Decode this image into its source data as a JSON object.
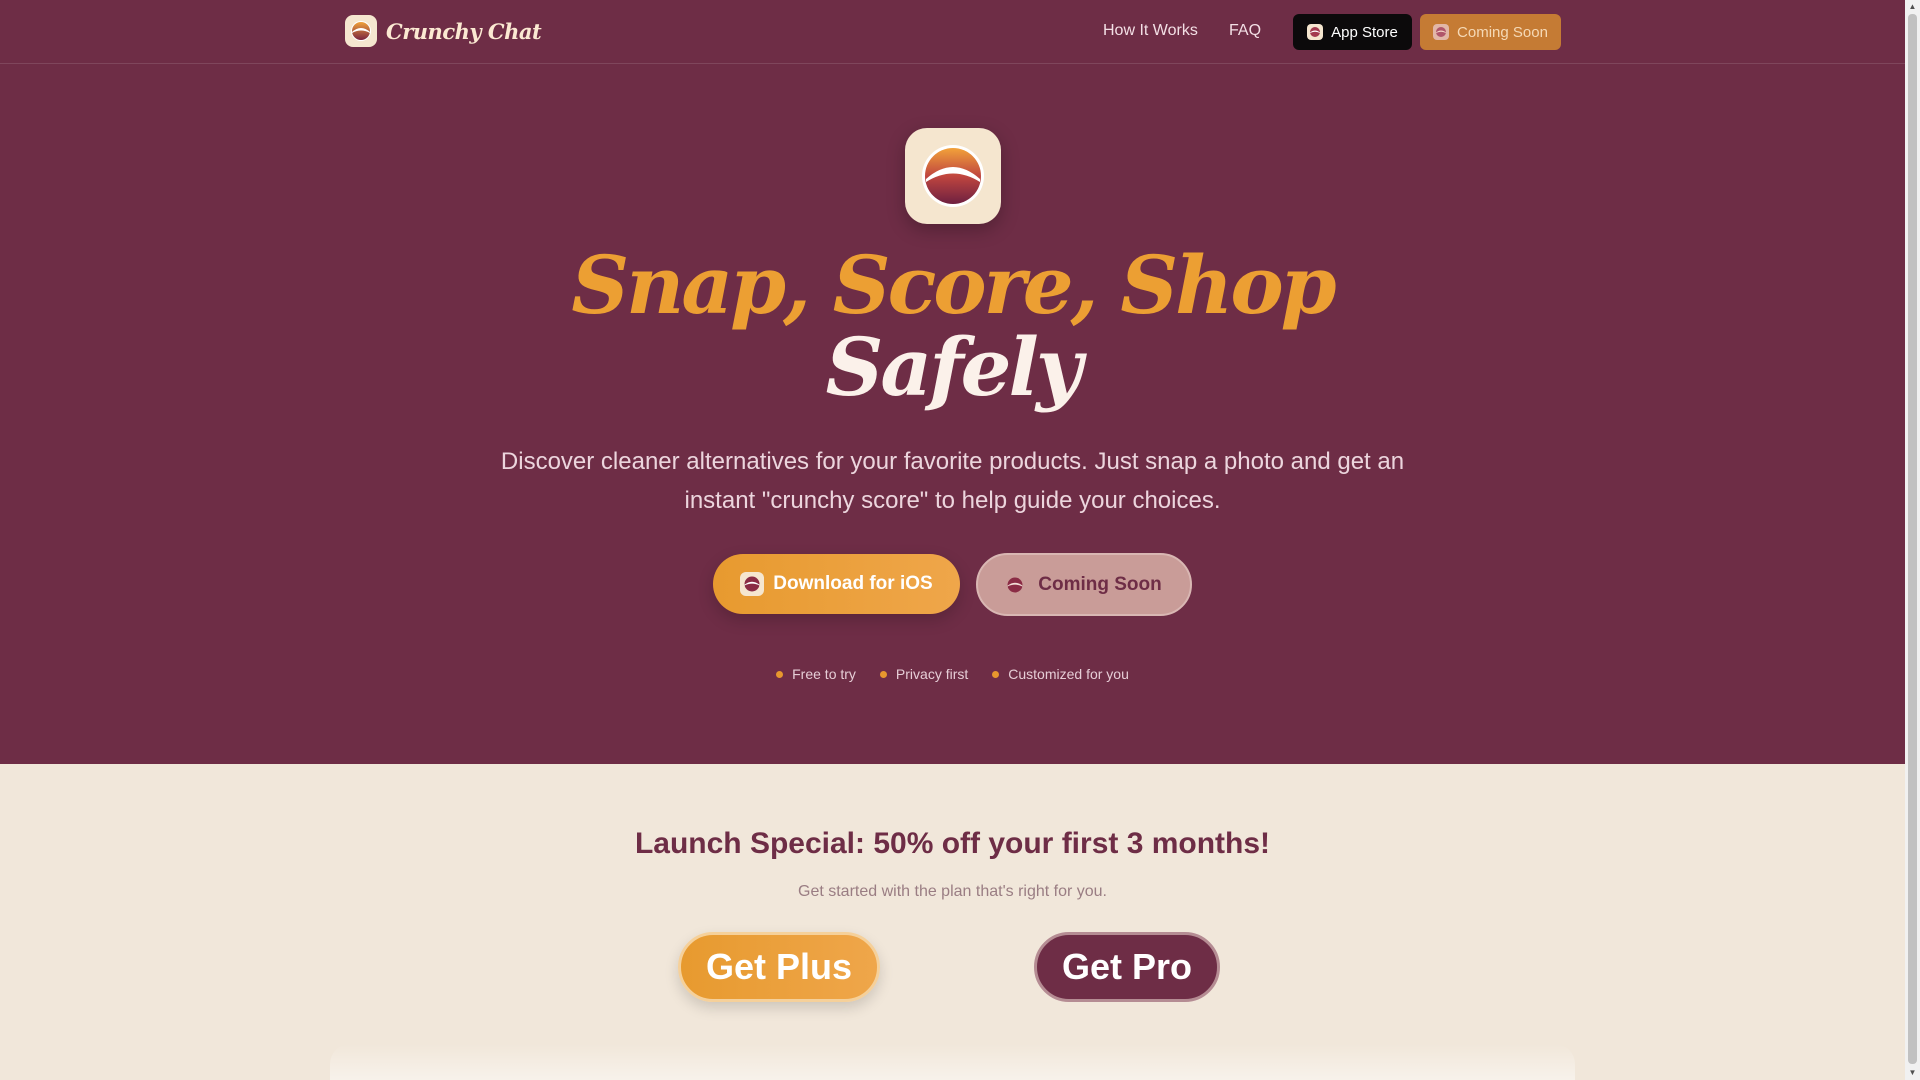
{
  "brand": {
    "name": "Crunchy Chat",
    "icon": "crunchy-logo-icon"
  },
  "nav": {
    "links": [
      "How It Works",
      "FAQ"
    ],
    "app_store_label": "App Store",
    "coming_soon_label": "Coming Soon"
  },
  "hero": {
    "headline_line1": "Snap, Score, Shop",
    "headline_line2": "Safely",
    "subtitle": "Discover cleaner alternatives for your favorite products. Just snap a photo and get an instant \"crunchy score\" to help guide your choices.",
    "cta_primary": "Download for iOS",
    "cta_secondary": "Coming Soon",
    "features": [
      "Free to try",
      "Privacy first",
      "Customized for you"
    ]
  },
  "pricing": {
    "headline": "Launch Special: 50% off your first 3 months!",
    "subheadline": "Get started with the plan that's right for you.",
    "plus_label": "Get Plus",
    "pro_label": "Get Pro"
  },
  "colors": {
    "brand_maroon": "#6e2d46",
    "accent_orange": "#ec9f33",
    "cream": "#f1e7da"
  }
}
